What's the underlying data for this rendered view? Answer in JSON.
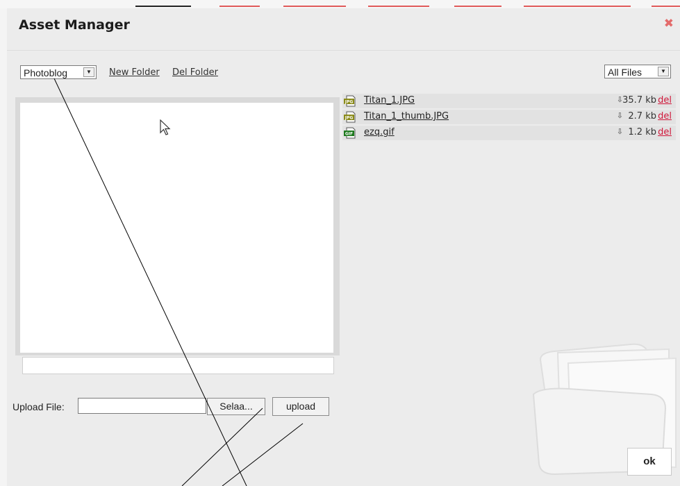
{
  "dialog": {
    "title": "Asset Manager",
    "close_icon": "close-icon"
  },
  "toolbar": {
    "folder_select": {
      "selected": "Photoblog"
    },
    "new_folder": "New Folder",
    "del_folder": "Del Folder",
    "filter_select": {
      "selected": "All Files"
    }
  },
  "files": [
    {
      "icon": "jpg-file-icon",
      "name": "Titan_1.JPG",
      "size": "35.7 kb",
      "delete": "del"
    },
    {
      "icon": "jpg-file-icon",
      "name": "Titan_1_thumb.JPG",
      "size": "2.7 kb",
      "delete": "del"
    },
    {
      "icon": "gif-file-icon",
      "name": "ezq.gif",
      "size": "1.2 kb",
      "delete": "del"
    }
  ],
  "upload": {
    "label": "Upload File:",
    "input_value": "",
    "browse_label": "Selaa...",
    "upload_label": "upload"
  },
  "ok_label": "ok",
  "colors": {
    "accent_red": "#d0173a",
    "close_red": "#e36b6b",
    "jpg_icon": "#8a8a18",
    "gif_icon": "#1e7a1e"
  }
}
